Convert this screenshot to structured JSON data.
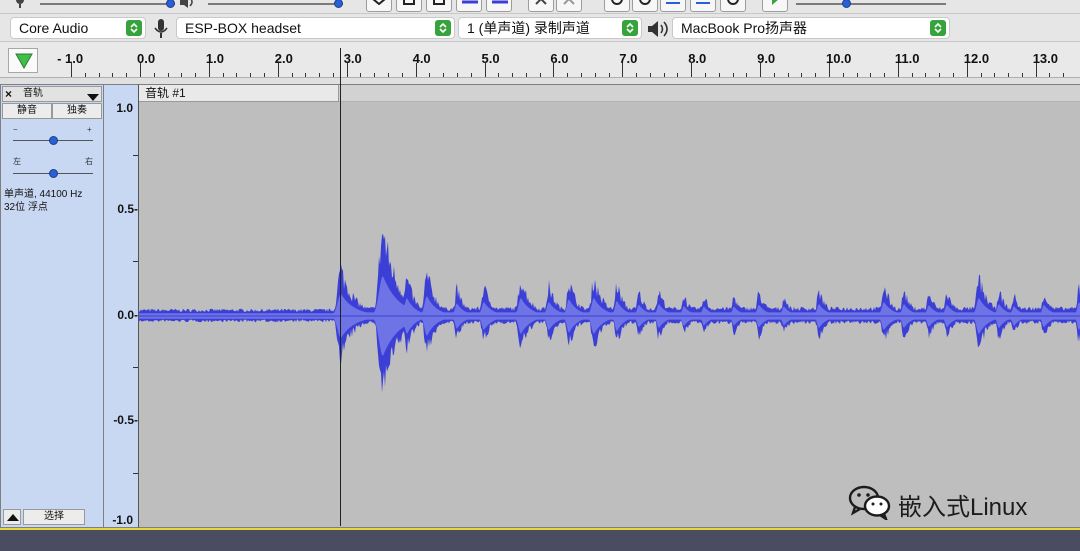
{
  "device_bar": {
    "host": "Core Audio",
    "recording_device": "ESP-BOX headset",
    "recording_channels": "1 (单声道) 录制声道",
    "playback_device": "MacBook Pro扬声器"
  },
  "ruler": {
    "ticks": [
      "- 1.0",
      "0.0",
      "1.0",
      "2.0",
      "3.0",
      "4.0",
      "5.0",
      "6.0",
      "7.0",
      "8.0",
      "9.0",
      "10.0",
      "11.0",
      "12.0",
      "13.0"
    ]
  },
  "track": {
    "menu_name": "音轨",
    "mute_label": "静音",
    "solo_label": "独奏",
    "gain_min": "−",
    "gain_max": "+",
    "pan_left": "左",
    "pan_right": "右",
    "info_line1": "单声道, 44100 Hz",
    "info_line2": "32位 浮点",
    "select_label": "选择",
    "title": "音轨 #1",
    "vscale": [
      "1.0",
      "0.5-",
      "0.0-",
      "-0.5-",
      "-1.0"
    ]
  },
  "watermark": {
    "text": "嵌入式Linux"
  },
  "colors": {
    "waveform": "#3b3fd6",
    "waveform_rms": "#6e73e6",
    "track_bg": "#bebebe"
  }
}
